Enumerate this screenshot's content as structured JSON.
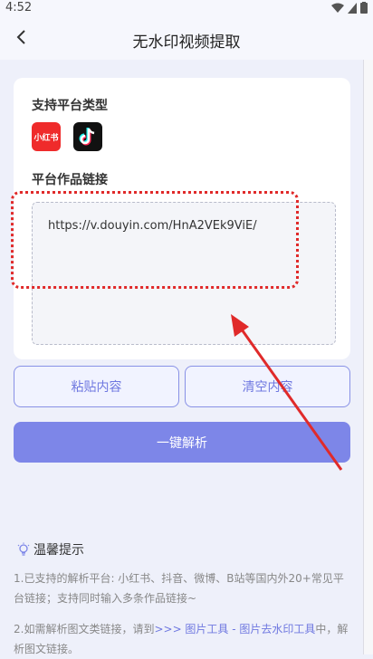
{
  "status": {
    "time": "4:52"
  },
  "header": {
    "title": "无水印视频提取"
  },
  "platforms": {
    "title": "支持平台类型",
    "items": [
      {
        "name": "小红书"
      },
      {
        "name": "抖音"
      }
    ]
  },
  "link": {
    "title": "平台作品链接",
    "value": "https://v.douyin.com/HnA2VEk9ViE/"
  },
  "buttons": {
    "paste": "粘贴内容",
    "clear": "清空内容",
    "parse": "一键解析"
  },
  "tips": {
    "title": "温馨提示",
    "line1": "1.已支持的解析平台: 小红书、抖音、微博、B站等国内外20+常见平台链接；支持同时输入多条作品链接~",
    "line2_prefix": "2.如需解析图文类链接，请到",
    "line2_link": ">>> 图片工具 - 图片去水印工具",
    "line2_suffix": "中，解析图文链接。"
  },
  "colors": {
    "accent": "#7d86e8",
    "annotation": "#e02a2a"
  }
}
